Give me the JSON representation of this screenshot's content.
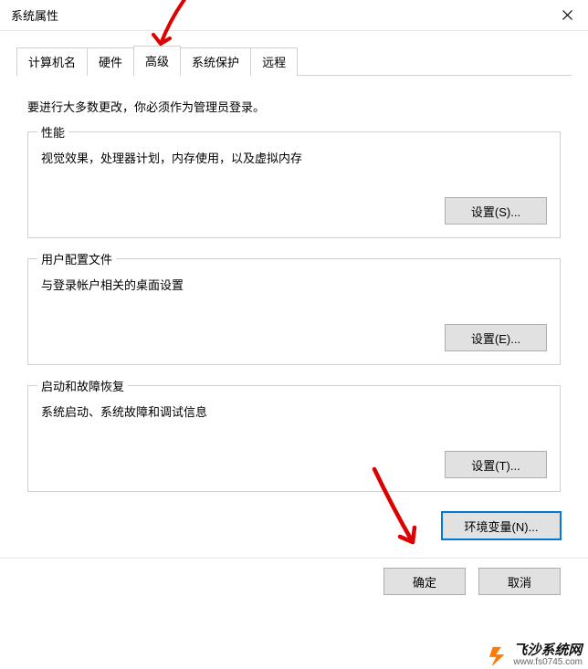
{
  "window": {
    "title": "系统属性"
  },
  "tabs": {
    "items": [
      {
        "label": "计算机名"
      },
      {
        "label": "硬件"
      },
      {
        "label": "高级"
      },
      {
        "label": "系统保护"
      },
      {
        "label": "远程"
      }
    ],
    "active_index": 2
  },
  "advanced": {
    "intro": "要进行大多数更改，你必须作为管理员登录。",
    "performance": {
      "title": "性能",
      "desc": "视觉效果，处理器计划，内存使用，以及虚拟内存",
      "button": "设置(S)..."
    },
    "profiles": {
      "title": "用户配置文件",
      "desc": "与登录帐户相关的桌面设置",
      "button": "设置(E)..."
    },
    "startup": {
      "title": "启动和故障恢复",
      "desc": "系统启动、系统故障和调试信息",
      "button": "设置(T)..."
    },
    "env_button": "环境变量(N)..."
  },
  "footer": {
    "ok": "确定",
    "cancel": "取消"
  },
  "watermark": {
    "name": "飞沙系统网",
    "url": "www.fs0745.com"
  }
}
